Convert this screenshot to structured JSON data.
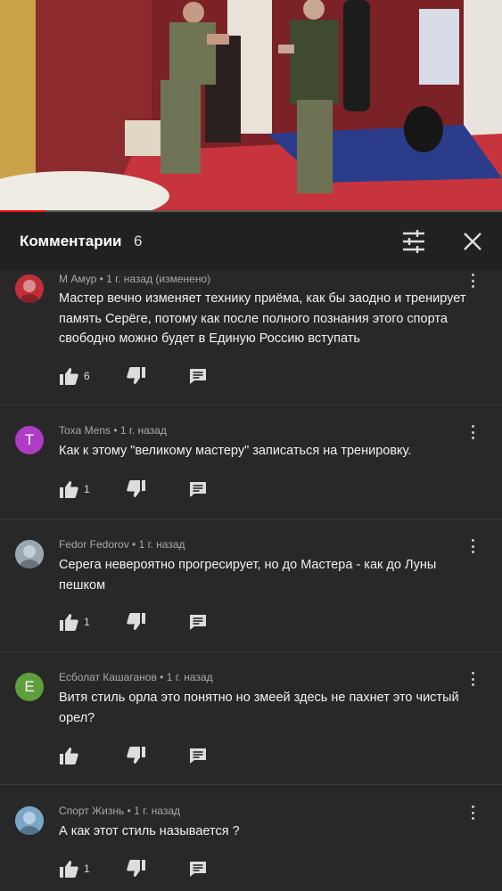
{
  "video": {
    "progress_fraction": 0.09
  },
  "header": {
    "title": "Комментарии",
    "count": "6"
  },
  "comments": [
    {
      "author": "М Амур",
      "time": " • 1 г. назад (изменено)",
      "text": "Мастер вечно изменяет технику приёма, как бы заодно и тренирует память Серёге, потому как после полного познания этого спорта свободно можно будет в Единую Россию вступать",
      "likes": "6",
      "avatar": {
        "type": "image",
        "color": "#c0303a"
      }
    },
    {
      "author": "Toxa Mens",
      "time": " • 1 г. назад",
      "text": "Как к этому \"великому мастеру\" записаться на тренировку.",
      "likes": "1",
      "avatar": {
        "type": "letter",
        "letter": "T",
        "color": "#b03bc4"
      }
    },
    {
      "author": "Fedor Fedorov",
      "time": " • 1 г. назад",
      "text": "Серега невероятно прогресирует, но до Мастера - как до Луны пешком",
      "likes": "1",
      "avatar": {
        "type": "image",
        "color": "#9aa6b2"
      }
    },
    {
      "author": "Есболат Кашаганов",
      "time": " • 1 г. назад",
      "text": "Витя стиль орла это понятно но змеей здесь не пахнет это чистый орел?",
      "likes": "",
      "avatar": {
        "type": "letter",
        "letter": "E",
        "color": "#5f9e3c"
      }
    },
    {
      "author": "Спорт Жизнь",
      "time": " • 1 г. назад",
      "text": "А как этот стиль называется ?",
      "likes": "1",
      "avatar": {
        "type": "image",
        "color": "#7aa6c8"
      }
    }
  ]
}
